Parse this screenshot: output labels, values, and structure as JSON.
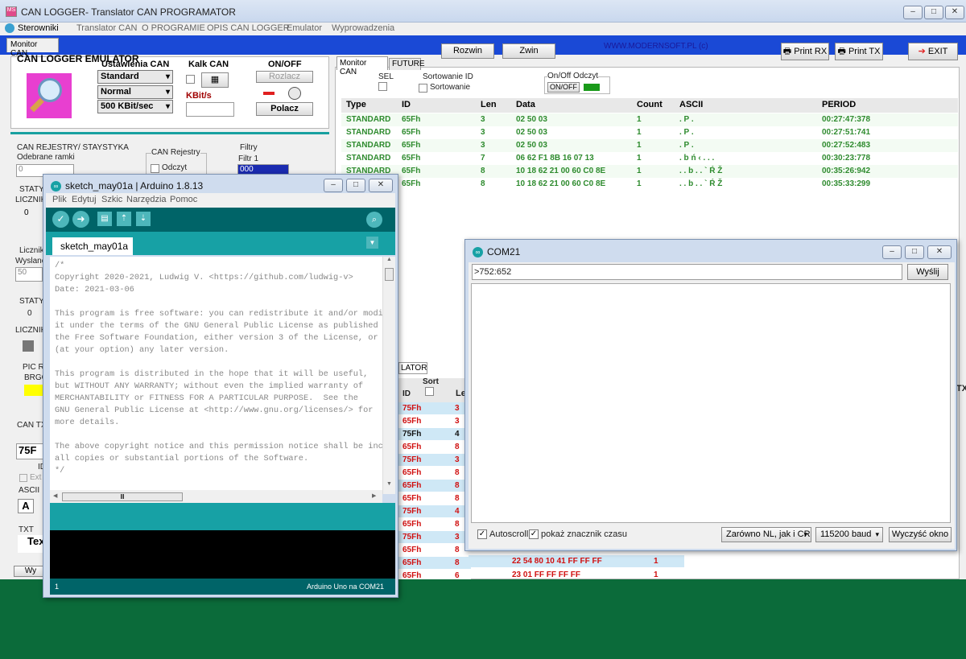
{
  "main_window": {
    "title": "CAN LOGGER- Translator CAN PROGRAMATOR",
    "menu": [
      "Sterowniki",
      "Translator CAN",
      "O PROGRAMIE",
      "OPIS CAN LOGGER",
      "Emulator",
      "Wyprowadzenia"
    ],
    "tab_monitor": "Monitor CAN",
    "buttons": {
      "rozwin": "Rozwin",
      "zwin": "Zwin",
      "print_rx": "Print RX",
      "print_tx": "Print TX",
      "exit": "EXIT"
    },
    "website": "WWW.MODERNSOFT.PL  (c)"
  },
  "left_panel": {
    "emulator_title": "CAN LOGGER EMULATOR",
    "ustawienia_title": "Ustawienia CAN",
    "frame_type": "Standard",
    "mode": "Normal",
    "bitrate": "500 KBit/sec",
    "kalk_title": "Kalk CAN",
    "kbit_label": "KBit/s",
    "onoff_title": "ON/OFF",
    "rozlacz": "Rozlacz",
    "polacz": "Polacz",
    "rejestry_title": "CAN REJESTRY/ STAYSTYKA",
    "odebrane": "Odebrane ramki",
    "odebrane_val": "0",
    "can_rejestry": "CAN Rejestry",
    "odczyt": "Odczyt",
    "filtry": "Filtry",
    "filtr1": "Filtr 1",
    "filtr1_val": "000",
    "stat1": "STATYS",
    "licznik1": "LICZNIK",
    "licznik1_val": "0",
    "licznik_label": "Licznik",
    "wyslane": "Wyslane",
    "wyslane_val": "50",
    "stat2": "STATYS",
    "stat2_val": "0",
    "licznik2": "LICZNIK",
    "pic_label": "PIC RE",
    "brgo": "BRGO",
    "can_tx": "CAN TX",
    "can_tx_id": "75F",
    "ext": "Ext",
    "ascii": "ASCII",
    "ascii_a": "A",
    "txt": "TXT",
    "tex": "Tex",
    "wy_btn": "Wy"
  },
  "monitor": {
    "tabs": [
      "Monitor CAN",
      "FUTURE"
    ],
    "sel": "SEL",
    "sort_id": "Sortowanie ID",
    "sort_label": "Sortowanie",
    "onoff_odczyt": "On/Off Odczyt",
    "onoff_btn": "ON/OFF",
    "columns": [
      "Type",
      "ID",
      "Len",
      "Data",
      "Count",
      "ASCII",
      "PERIOD"
    ],
    "rows": [
      [
        "STANDARD",
        "65Fh",
        "3",
        "02 50 03",
        "1",
        ". P .",
        "00:27:47:378"
      ],
      [
        "STANDARD",
        "65Fh",
        "3",
        "02 50 03",
        "1",
        ". P .",
        "00:27:51:741"
      ],
      [
        "STANDARD",
        "65Fh",
        "3",
        "02 50 03",
        "1",
        ". P .",
        "00:27:52:483"
      ],
      [
        "STANDARD",
        "65Fh",
        "7",
        "06 62 F1 8B 16 07 13",
        "1",
        ". b ń ‹ . . .",
        "00:30:23:778"
      ],
      [
        "STANDARD",
        "65Fh",
        "8",
        "10 18 62 21 00 60 C0 8E",
        "1",
        ". . b . . ` Ŕ Ž",
        "00:35:26:942"
      ],
      [
        "STANDARD",
        "65Fh",
        "8",
        "10 18 62 21 00 60 C0 8E",
        "1",
        ". . b . . ` Ŕ Ž",
        "00:35:33:299"
      ]
    ]
  },
  "lower_table": {
    "tab_partial": "LATOR",
    "sort": "Sort",
    "id_col": "ID",
    "len_col": "Le",
    "tx_col": "TX",
    "rows": [
      {
        "id": "75Fh",
        "len": "3",
        "color": "#d01010"
      },
      {
        "id": "65Fh",
        "len": "3",
        "color": "#d01010"
      },
      {
        "id": "75Fh",
        "len": "4",
        "color": "#111111"
      },
      {
        "id": "65Fh",
        "len": "8",
        "color": "#d01010"
      },
      {
        "id": "75Fh",
        "len": "3",
        "color": "#d01010"
      },
      {
        "id": "65Fh",
        "len": "8",
        "color": "#d01010"
      },
      {
        "id": "65Fh",
        "len": "8",
        "color": "#d01010"
      },
      {
        "id": "65Fh",
        "len": "8",
        "color": "#d01010"
      },
      {
        "id": "75Fh",
        "len": "4",
        "color": "#d01010"
      },
      {
        "id": "65Fh",
        "len": "8",
        "color": "#d01010"
      },
      {
        "id": "75Fh",
        "len": "3",
        "color": "#d01010"
      },
      {
        "id": "65Fh",
        "len": "8",
        "color": "#d01010"
      },
      {
        "id": "65Fh",
        "len": "8",
        "color": "#d01010"
      },
      {
        "id": "65Fh",
        "len": "6",
        "color": "#d01010"
      }
    ],
    "extra_data": [
      {
        "data": "22 54 80 10 41 FF FF FF",
        "count": "1"
      },
      {
        "data": "23 01 FF FF FF FF",
        "count": "1"
      }
    ]
  },
  "arduino": {
    "title": "sketch_may01a | Arduino 1.8.13",
    "menu": [
      "Plik",
      "Edytuj",
      "Szkic",
      "Narzędzia",
      "Pomoc"
    ],
    "tab": "sketch_may01a",
    "code_lines": [
      "/*",
      "Copyright 2020-2021, Ludwig V. <https://github.com/ludwig-v>",
      "Date: 2021-03-06",
      "",
      "This program is free software: you can redistribute it and/or modi",
      "it under the terms of the GNU General Public License as published",
      "the Free Software Foundation, either version 3 of the License, or",
      "(at your option) any later version.",
      "",
      "This program is distributed in the hope that it will be useful,",
      "but WITHOUT ANY WARRANTY; without even the implied warranty of",
      "MERCHANTABILITY or FITNESS FOR A PARTICULAR PURPOSE.  See the",
      "GNU General Public License at <http://www.gnu.org/licenses/> for",
      "more details.",
      "",
      "The above copyright notice and this permission notice shall be inc",
      "all copies or substantial portions of the Software.",
      "*/",
      "",
      "////////////////////"
    ],
    "line_number": "1",
    "board": "Arduino Uno na COM21"
  },
  "com": {
    "title": "COM21",
    "input_value": ">752:652",
    "send": "Wyślij",
    "autoscroll": "Autoscroll",
    "timestamp": "pokaż znacznik czasu",
    "line_ending": "Zarówno NL, jak i CR",
    "baud": "115200 baud",
    "clear": "Wyczyść okno"
  },
  "colors": {
    "accent_blue": "#1a49d6",
    "teal": "#17a1a5",
    "green_text": "#2e8b2e",
    "desktop": "#0b6b3a"
  }
}
